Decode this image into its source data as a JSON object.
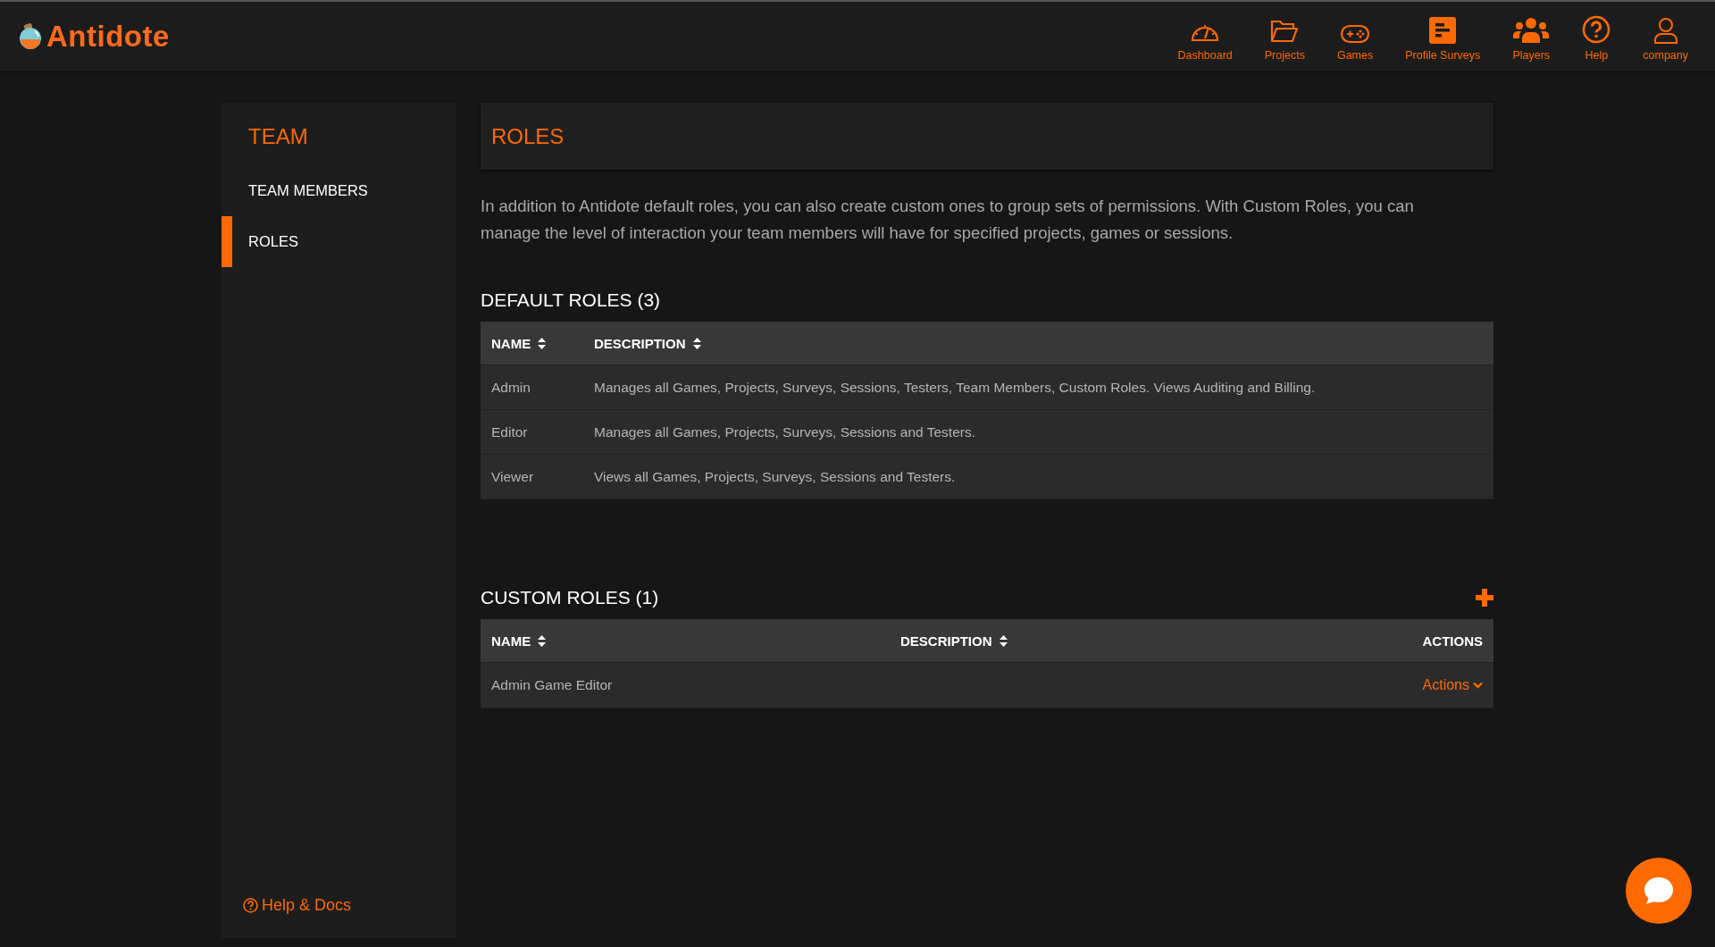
{
  "header": {
    "logo": "Antidote",
    "nav": [
      {
        "label": "Dashboard"
      },
      {
        "label": "Projects"
      },
      {
        "label": "Games"
      },
      {
        "label": "Profile Surveys"
      },
      {
        "label": "Players"
      },
      {
        "label": "Help"
      },
      {
        "label": "company"
      }
    ]
  },
  "sidebar": {
    "title": "TEAM",
    "items": [
      {
        "label": "TEAM MEMBERS",
        "selected": false
      },
      {
        "label": "ROLES",
        "selected": true
      }
    ],
    "help_link": "Help & Docs"
  },
  "page": {
    "title": "ROLES",
    "intro": "In addition to Antidote default roles, you can also create custom ones to group sets of permissions. With Custom Roles, you can manage the level of interaction your team members will have for specified projects, games or sessions."
  },
  "default_roles": {
    "heading": "DEFAULT ROLES (3)",
    "columns": [
      {
        "label": "NAME",
        "sortable": true
      },
      {
        "label": "DESCRIPTION",
        "sortable": true
      }
    ],
    "rows": [
      [
        "Admin",
        "Manages all Games, Projects, Surveys, Sessions, Testers, Team Members, Custom Roles. Views Auditing and Billing."
      ],
      [
        "Editor",
        "Manages all Games, Projects, Surveys, Sessions and Testers."
      ],
      [
        "Viewer",
        "Views all Games, Projects, Surveys, Sessions and Testers."
      ]
    ]
  },
  "custom_roles": {
    "heading": "CUSTOM ROLES (1)",
    "columns": [
      {
        "label": "NAME",
        "sortable": true
      },
      {
        "label": "DESCRIPTION",
        "sortable": true
      },
      {
        "label": "ACTIONS",
        "sortable": false
      }
    ],
    "rows": [
      {
        "name": "Admin Game Editor",
        "description": "",
        "action": "Actions"
      }
    ]
  }
}
